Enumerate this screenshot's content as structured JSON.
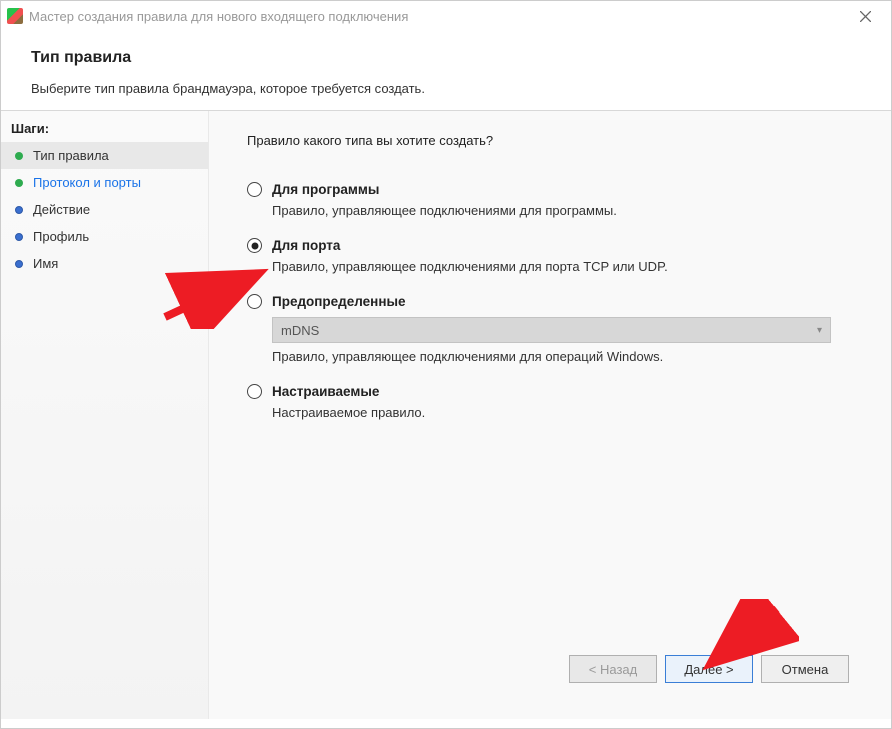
{
  "titlebar": {
    "title": "Мастер создания правила для нового входящего подключения"
  },
  "header": {
    "title": "Тип правила",
    "subtitle": "Выберите тип правила брандмауэра, которое требуется создать."
  },
  "sidebar": {
    "heading": "Шаги:",
    "items": [
      {
        "label": "Тип правила"
      },
      {
        "label": "Протокол и порты"
      },
      {
        "label": "Действие"
      },
      {
        "label": "Профиль"
      },
      {
        "label": "Имя"
      }
    ]
  },
  "content": {
    "question": "Правило какого типа вы хотите создать?",
    "options": [
      {
        "label": "Для программы",
        "desc": "Правило, управляющее подключениями для программы."
      },
      {
        "label": "Для порта",
        "desc": "Правило, управляющее подключениями для порта TCP или UDP."
      },
      {
        "label": "Предопределенные",
        "desc": "Правило, управляющее подключениями для операций Windows.",
        "dropdown": "mDNS"
      },
      {
        "label": "Настраиваемые",
        "desc": "Настраиваемое правило."
      }
    ]
  },
  "buttons": {
    "back": "< Назад",
    "next": "Далее >",
    "cancel": "Отмена"
  }
}
